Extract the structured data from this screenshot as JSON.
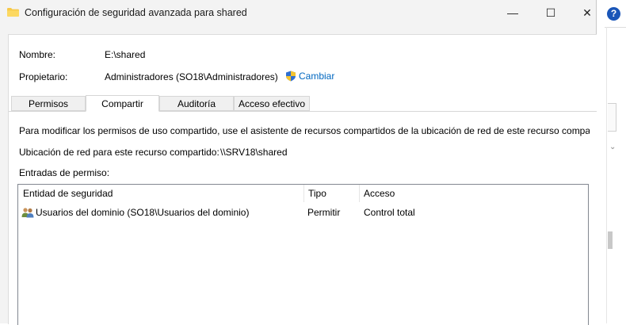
{
  "window": {
    "title": "Configuración de seguridad avanzada para shared",
    "controls": {
      "minimize": "—",
      "maximize": "☐",
      "close": "✕"
    }
  },
  "background_window": {
    "help_label": "?"
  },
  "fields": {
    "name_label": "Nombre:",
    "name_value": "E:\\shared",
    "owner_label": "Propietario:",
    "owner_value": "Administradores (SO18\\Administradores)",
    "change_link": "Cambiar"
  },
  "tabs": [
    {
      "label": "Permisos",
      "active": false
    },
    {
      "label": "Compartir",
      "active": true
    },
    {
      "label": "Auditoría",
      "active": false
    },
    {
      "label": "Acceso efectivo",
      "active": false
    }
  ],
  "share_tab": {
    "info_text": "Para modificar los permisos de uso compartido, use el asistente de recursos compartidos de la ubicación de red de este recurso comparti",
    "network_location_label": "Ubicación de red para este recurso compartido:",
    "network_location_value": "\\\\SRV18\\shared",
    "entries_label": "Entradas de permiso:"
  },
  "permission_list": {
    "columns": [
      "Entidad de seguridad",
      "Tipo",
      "Acceso"
    ],
    "rows": [
      {
        "entity": "Usuarios del dominio (SO18\\Usuarios del dominio)",
        "type": "Permitir",
        "access": "Control total",
        "icon": "users-group-icon"
      }
    ]
  },
  "colors": {
    "link": "#0067c0",
    "help_badge": "#1a56b8",
    "folder": "#f7c948"
  }
}
